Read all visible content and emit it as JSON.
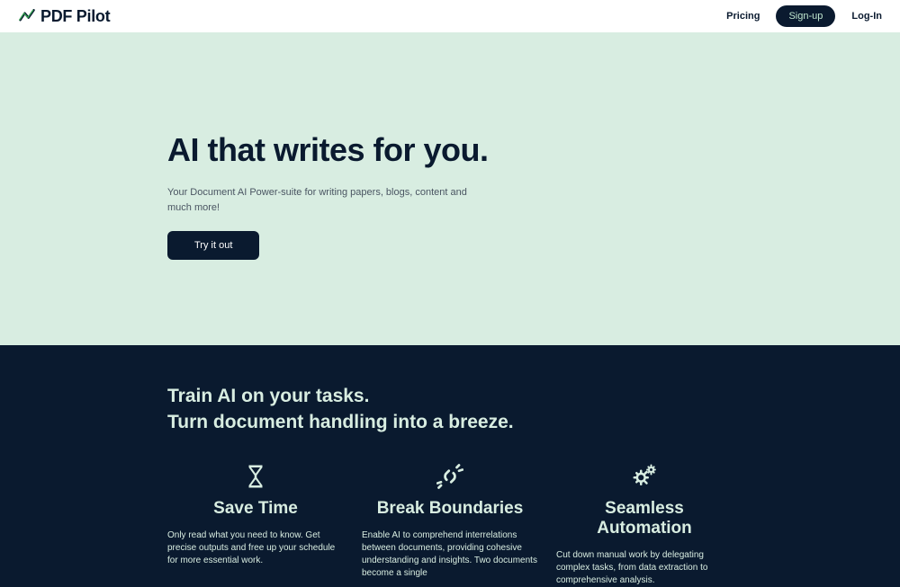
{
  "header": {
    "logo_text": "PDF Pilot",
    "nav": {
      "pricing": "Pricing",
      "signup": "Sign-up",
      "login": "Log-In"
    }
  },
  "hero": {
    "title": "AI that writes for you.",
    "subtitle": "Your Document AI Power-suite for writing papers, blogs, content and much more!",
    "cta": "Try it out"
  },
  "features": {
    "heading_line1": "Train AI on your tasks.",
    "heading_line2": "Turn document handling into a breeze.",
    "items": [
      {
        "title": "Save Time",
        "desc": "Only read what you need to know. Get precise outputs and free up your schedule for more essential work."
      },
      {
        "title": "Break Boundaries",
        "desc": "Enable AI to comprehend interrelations between documents, providing cohesive understanding and insights. Two documents become a single"
      },
      {
        "title": "Seamless Automation",
        "desc": "Cut down manual work by delegating complex tasks, from data extraction to comprehensive analysis."
      }
    ]
  }
}
